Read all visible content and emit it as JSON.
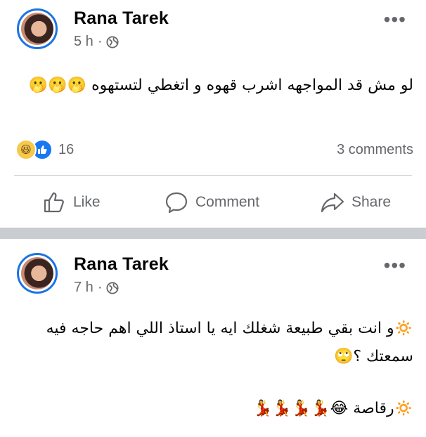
{
  "posts": [
    {
      "author": "Rana Tarek",
      "time": "5 h",
      "sep": "·",
      "more": "•••",
      "text": "لو مش قد المواجهه اشرب قهوه و اتغطي لتستهوه 🫢🫢🫢",
      "reactions": {
        "icons": [
          "haha-icon",
          "like-icon"
        ],
        "count": "16"
      },
      "comments": "3 comments",
      "actions": {
        "like": "Like",
        "comment": "Comment",
        "share": "Share"
      }
    },
    {
      "author": "Rana Tarek",
      "time": "7 h",
      "sep": "·",
      "more": "•••",
      "lines": [
        "🔅و انت بقي طبيعة شغلك ايه يا استاذ اللي اهم حاجه فيه سمعتك ؟🙄",
        "🔅رقاصة 😂💃💃💃💃"
      ]
    }
  ],
  "colors": {
    "accent": "#1877f2",
    "secondary_text": "#65676b",
    "divider": "#c9ccd1"
  }
}
